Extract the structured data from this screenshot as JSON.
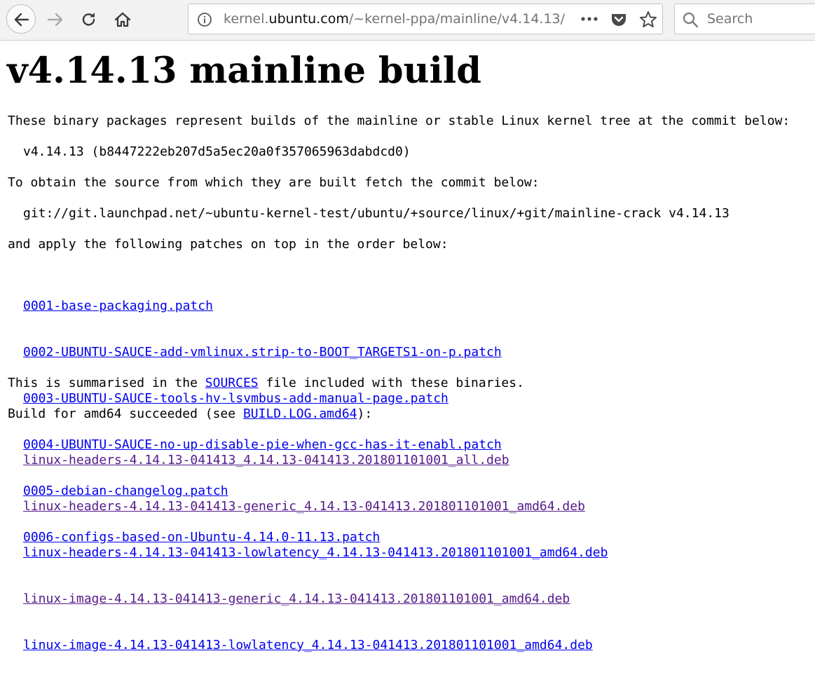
{
  "browser": {
    "url_domain_prefix": "kernel.",
    "url_domain": "ubuntu.com",
    "url_path": "/~kernel-ppa/mainline/v4.14.13/",
    "search_placeholder": "Search"
  },
  "page": {
    "title": "v4.14.13 mainline build",
    "intro": "These binary packages represent builds of the mainline or stable Linux kernel tree at the commit below:",
    "commit": "v4.14.13 (b8447222eb207d5a5ec20a0f357065963dabdcd0)",
    "obtain_text": "To obtain the source from which they are built fetch the commit below:",
    "git_line": "git://git.launchpad.net/~ubuntu-kernel-test/ubuntu/+source/linux/+git/mainline-crack v4.14.13",
    "apply_text": "and apply the following patches on top in the order below:",
    "patches": [
      "0001-base-packaging.patch",
      "0002-UBUNTU-SAUCE-add-vmlinux.strip-to-BOOT_TARGETS1-on-p.patch",
      "0003-UBUNTU-SAUCE-tools-hv-lsvmbus-add-manual-page.patch",
      "0004-UBUNTU-SAUCE-no-up-disable-pie-when-gcc-has-it-enabl.patch",
      "0005-debian-changelog.patch",
      "0006-configs-based-on-Ubuntu-4.14.0-11.13.patch"
    ],
    "summary_prefix": "This is summarised in the ",
    "summary_link": "SOURCES",
    "summary_suffix": " file included with these binaries.",
    "build_prefix": "Build for amd64 succeeded (see ",
    "build_link": "BUILD.LOG.amd64",
    "build_suffix": "):",
    "debs": [
      {
        "name": "linux-headers-4.14.13-041413_4.14.13-041413.201801101001_all.deb",
        "visited": true
      },
      {
        "name": "linux-headers-4.14.13-041413-generic_4.14.13-041413.201801101001_amd64.deb",
        "visited": true
      },
      {
        "name": "linux-headers-4.14.13-041413-lowlatency_4.14.13-041413.201801101001_amd64.deb",
        "visited": false
      },
      {
        "name": "linux-image-4.14.13-041413-generic_4.14.13-041413.201801101001_amd64.deb",
        "visited": true
      },
      {
        "name": "linux-image-4.14.13-041413-lowlatency_4.14.13-041413.201801101001_amd64.deb",
        "visited": false
      }
    ]
  },
  "colors": {
    "link": "#0000ee",
    "visited_link": "#551a8b"
  }
}
